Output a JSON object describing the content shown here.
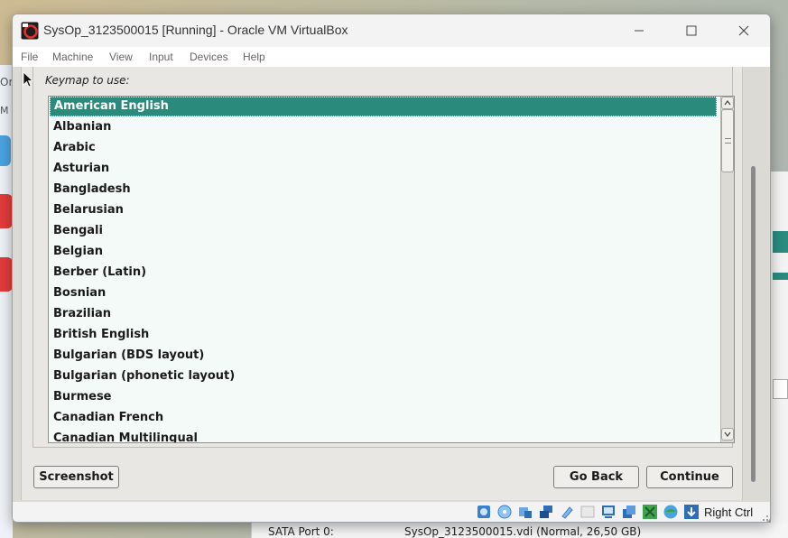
{
  "window": {
    "title": "SysOp_3123500015 [Running] - Oracle VM VirtualBox",
    "minimize_icon": "minimize-icon",
    "maximize_icon": "maximize-icon",
    "close_icon": "close-icon"
  },
  "menu": [
    "File",
    "Machine",
    "View",
    "Input",
    "Devices",
    "Help"
  ],
  "background": {
    "left_texts": [
      "Ora",
      "M"
    ],
    "bottom_label": "SATA Port 0:",
    "bottom_value": "SysOp_3123500015.vdi (Normal, 26,50 GB)"
  },
  "installer": {
    "keymap_label": "Keymap to use:",
    "keymaps": [
      "American English",
      "Albanian",
      "Arabic",
      "Asturian",
      "Bangladesh",
      "Belarusian",
      "Bengali",
      "Belgian",
      "Berber (Latin)",
      "Bosnian",
      "Brazilian",
      "British English",
      "Bulgarian (BDS layout)",
      "Bulgarian (phonetic layout)",
      "Burmese",
      "Canadian French",
      "Canadian Multilingual"
    ],
    "selected_keymap": "American English",
    "screenshot_button": "Screenshot",
    "go_back_button": "Go Back",
    "continue_button": "Continue"
  },
  "statusbar": {
    "icons": [
      "hard-disk-icon",
      "optical-drive-icon",
      "audio-icon",
      "network-icon",
      "usb-icon",
      "shared-folders-icon",
      "display-icon",
      "video-capture-icon",
      "mouse-integration-icon",
      "cpu-icon",
      "keyboard-icon"
    ],
    "host_key": "Right Ctrl"
  },
  "colors": {
    "selection": "#2a8a7c",
    "list_background": "#f4faf7",
    "panel": "#e8e7e3"
  }
}
